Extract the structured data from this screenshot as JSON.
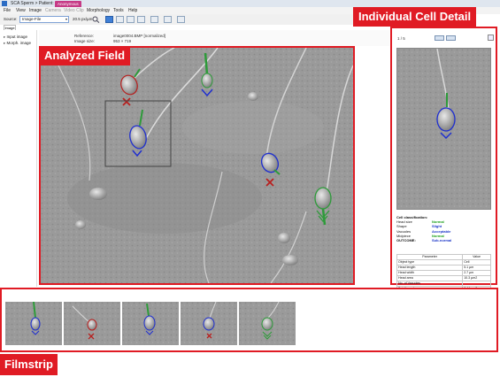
{
  "window": {
    "title": "SCA Sperm > Patient: Anonymous",
    "tab_label": "Anonymous"
  },
  "menu": [
    "File",
    "View",
    "Image",
    "Camera",
    "Video Clip",
    "Morphology",
    "Tools",
    "Help"
  ],
  "toolbar": {
    "source_label": "Source:",
    "source_value": "Image-File",
    "resolution": "20.5 px/µm"
  },
  "image_tab": "Image",
  "tree": [
    "Input image",
    "Morph. image"
  ],
  "info": {
    "reference_label": "Reference:",
    "reference_value": "image0004.BMP [normalized]",
    "image_size_label": "Image size:",
    "image_size_value": "953 × 719"
  },
  "labels": {
    "analyzed_field": "Analyzed Field",
    "cell_detail": "Individual Cell Detail",
    "filmstrip": "Filmstrip"
  },
  "cell_detail": {
    "counter": "1 / 5",
    "classification_title": "Cell classification:",
    "classification": [
      {
        "label": "Head size",
        "value": "Normal",
        "color": "#1a9e1a"
      },
      {
        "label": "Shape",
        "value": "Slight",
        "color": "#1a35c8"
      },
      {
        "label": "Vacuoles",
        "value": "Acceptable",
        "color": "#1a35c8"
      },
      {
        "label": "Midpiece",
        "value": "Normal",
        "color": "#1a9e1a"
      },
      {
        "label": "OUTCOME:",
        "value": "Sub-normal",
        "color": "#1a35c8"
      }
    ],
    "params_header": [
      "Parameter",
      "Value"
    ],
    "params": [
      [
        "Object type",
        "Cell"
      ],
      [
        "Head length",
        "5.1 µm"
      ],
      [
        "Head width",
        "2.7 µm"
      ],
      [
        "Head area",
        "10.3 µm2"
      ],
      [
        "No. of Vacuoles",
        ""
      ],
      [
        "Tot. Vacuole area",
        "0.44 µm2"
      ],
      [
        "Rel. Vacuole area",
        "2.5 %"
      ],
      [
        "Vacuole in PA",
        "No"
      ]
    ]
  },
  "colors": {
    "annotation_red": "#e01b24",
    "normal_green": "#2e9b3a",
    "abnormal_blue": "#1f2fd0",
    "reject_red": "#b8201f"
  },
  "icons": [
    "zoom-icon",
    "grid-icon",
    "save-icon",
    "export-icon"
  ]
}
